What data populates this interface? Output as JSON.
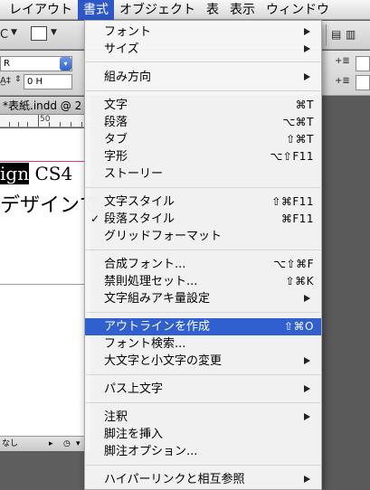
{
  "menubar": {
    "items": [
      "レイアウト",
      "書式",
      "オブジェクト",
      "表",
      "表示",
      "ウィンドウ"
    ],
    "active_index": 1
  },
  "app": {
    "document_tab": "*表紙.indd @ 2",
    "ruler_label": "50",
    "doc_text_selected": "ign",
    "doc_text_rest": " CS4",
    "doc_text_line2": "デザインで",
    "status_text": "なし",
    "field_value": "0 H",
    "toolbar_glyph_left": "C",
    "toolbar_glyph_r": "R"
  },
  "menu": {
    "items": [
      {
        "label": "フォント",
        "shortcut": "",
        "submenu": true
      },
      {
        "label": "サイズ",
        "shortcut": "",
        "submenu": true
      },
      {
        "label": "組み方向",
        "shortcut": "",
        "submenu": true
      },
      {
        "label": "文字",
        "shortcut": "⌘T",
        "submenu": false
      },
      {
        "label": "段落",
        "shortcut": "⌥⌘T",
        "submenu": false
      },
      {
        "label": "タブ",
        "shortcut": "⇧⌘T",
        "submenu": false
      },
      {
        "label": "字形",
        "shortcut": "⌥⇧F11",
        "submenu": false
      },
      {
        "label": "ストーリー",
        "shortcut": "",
        "submenu": false
      },
      {
        "label": "文字スタイル",
        "shortcut": "⇧⌘F11",
        "submenu": false
      },
      {
        "label": "段落スタイル",
        "shortcut": "⌘F11",
        "submenu": false,
        "checked": true
      },
      {
        "label": "グリッドフォーマット",
        "shortcut": "",
        "submenu": false
      },
      {
        "label": "合成フォント...",
        "shortcut": "⌥⇧⌘F",
        "submenu": false
      },
      {
        "label": "禁則処理セット...",
        "shortcut": "⇧⌘K",
        "submenu": false
      },
      {
        "label": "文字組みアキ量設定",
        "shortcut": "",
        "submenu": true
      },
      {
        "label": "アウトラインを作成",
        "shortcut": "⇧⌘O",
        "submenu": false,
        "highlighted": true
      },
      {
        "label": "フォント検索...",
        "shortcut": "",
        "submenu": false
      },
      {
        "label": "大文字と小文字の変更",
        "shortcut": "",
        "submenu": true
      },
      {
        "label": "パス上文字",
        "shortcut": "",
        "submenu": true
      },
      {
        "label": "注釈",
        "shortcut": "",
        "submenu": true
      },
      {
        "label": "脚注を挿入",
        "shortcut": "",
        "submenu": false
      },
      {
        "label": "脚注オプション...",
        "shortcut": "",
        "submenu": false
      },
      {
        "label": "ハイパーリンクと相互参照",
        "shortcut": "",
        "submenu": true
      }
    ],
    "check_mark": "✓"
  },
  "colors": {
    "menu_highlight": "#3060d0",
    "menubar_active": "#2d57c6",
    "guide": "#d23c8c"
  }
}
